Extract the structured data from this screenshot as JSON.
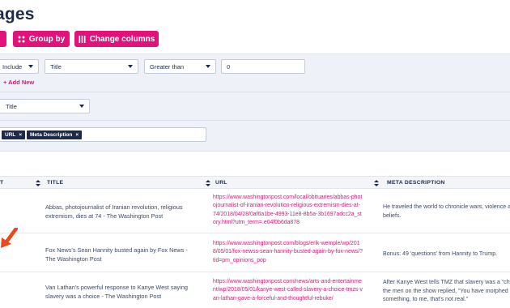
{
  "page": {
    "title": "ages"
  },
  "toolbar": {
    "group_by_label": "Group by",
    "change_columns_label": "Change columns"
  },
  "filters": {
    "include": "Include",
    "field": "Title",
    "operator": "Greater than",
    "value": "0",
    "add_new": "+ Add New"
  },
  "sort_field": "Title",
  "columns": {
    "selected": [
      "URL",
      "Meta Description"
    ],
    "remove_glyph": "×"
  },
  "table": {
    "headers": [
      "T",
      "TITLE",
      "URL",
      "META DESCRIPTION"
    ],
    "rows": [
      {
        "title": "Abbas, photojournalist of Iranian revolution, religious extremism, dies at 74 - The Washington Post",
        "url": "https://www.washingtonpost.com/local/obituaries/abbas-photojournalist-of-iranian-revolution-religious-extremism-dies-at-74/2018/04/28/0af6a1be-4993-11e8-8b5a-3b1697adcc2a_story.html?utm_term=.e04f0b6da878",
        "meta": [
          "He traveled the world to chronicle wars, violence an",
          "beliefs."
        ]
      },
      {
        "title": "Fox News's Sean Hannity busted again by Fox News - The Washington Post",
        "url": "https://www.washingtonpost.com/blogs/erik-wemple/wp/2018/05/01/fox-newss-sean-hannity-busted-again-by-fox-news/?tid=pm_opinions_pop",
        "meta": [
          "Bonus: 49 'questions' from Hannity to Trump."
        ]
      },
      {
        "title": "Van Lathan's powerful response to Kanye West saying slavery was a choice - The Washington Post",
        "url": "https://www.washingtonpost.com/news/arts-and-entertainment/wp/2018/05/01/kanye-west-called-slavery-a-choice-tmzs-van-lathan-gave-a-forceful-and-thoughtful-rebuke/",
        "meta": [
          "After Kanye West tells TMZ that slavery was a “cho",
          "the men on the show replied, “You have morphed in",
          "something, to me, that's not real.”"
        ]
      }
    ]
  },
  "colors": {
    "accent": "#e3117a",
    "navy": "#1c2b4a",
    "panel": "#eef1f7",
    "arrow": "#e8491d"
  },
  "icons": {
    "group_by": "grid-dots-icon",
    "change_columns": "columns-icon",
    "sort": "sort-arrows-icon"
  }
}
